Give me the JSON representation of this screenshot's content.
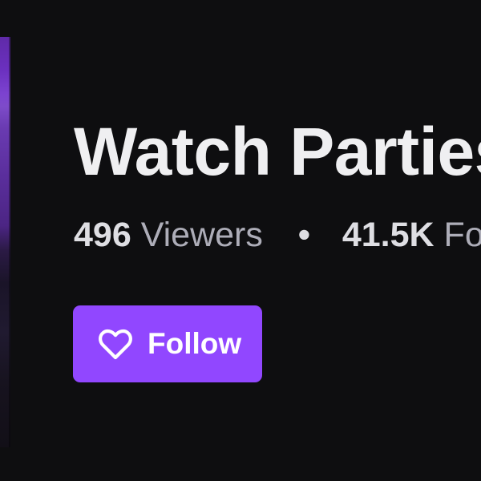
{
  "category": {
    "title": "Watch Parties"
  },
  "stats": {
    "viewers_count": "496",
    "viewers_label": "Viewers",
    "separator": "•",
    "followers_count": "41.5K",
    "followers_label": "Followers"
  },
  "follow_button": {
    "label": "Follow",
    "icon": "heart-icon"
  },
  "colors": {
    "background": "#0e0e10",
    "accent": "#9147ff",
    "text_primary": "#efeff1",
    "text_secondary": "#adadb8"
  }
}
